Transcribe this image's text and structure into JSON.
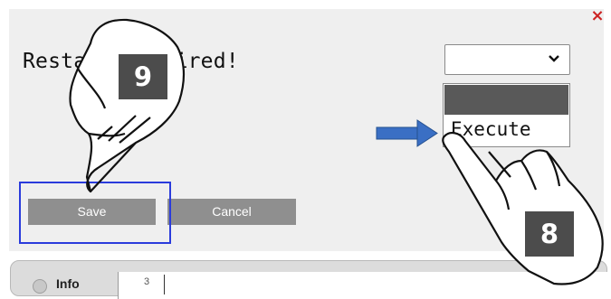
{
  "dialog": {
    "close_label": "×",
    "message": "Restart required!"
  },
  "select": {
    "selected_value": "",
    "options": [
      "",
      "Execute"
    ],
    "highlighted_option": ""
  },
  "buttons": {
    "save_label": "Save",
    "cancel_label": "Cancel"
  },
  "info_panel": {
    "label": "Info",
    "number": "3"
  },
  "annotations": {
    "step_a": "9",
    "step_b": "8"
  },
  "colors": {
    "button_bg": "#8f8f8f",
    "focus_border": "#2a3bdc",
    "arrow": "#3a6fc4",
    "close": "#cc2222",
    "badge_bg": "#4c4c4c"
  },
  "icons": {
    "close": "close-icon",
    "dropdown": "chevron-down-icon",
    "pointer": "hand-pointer-icon",
    "arrow": "right-arrow-icon"
  }
}
